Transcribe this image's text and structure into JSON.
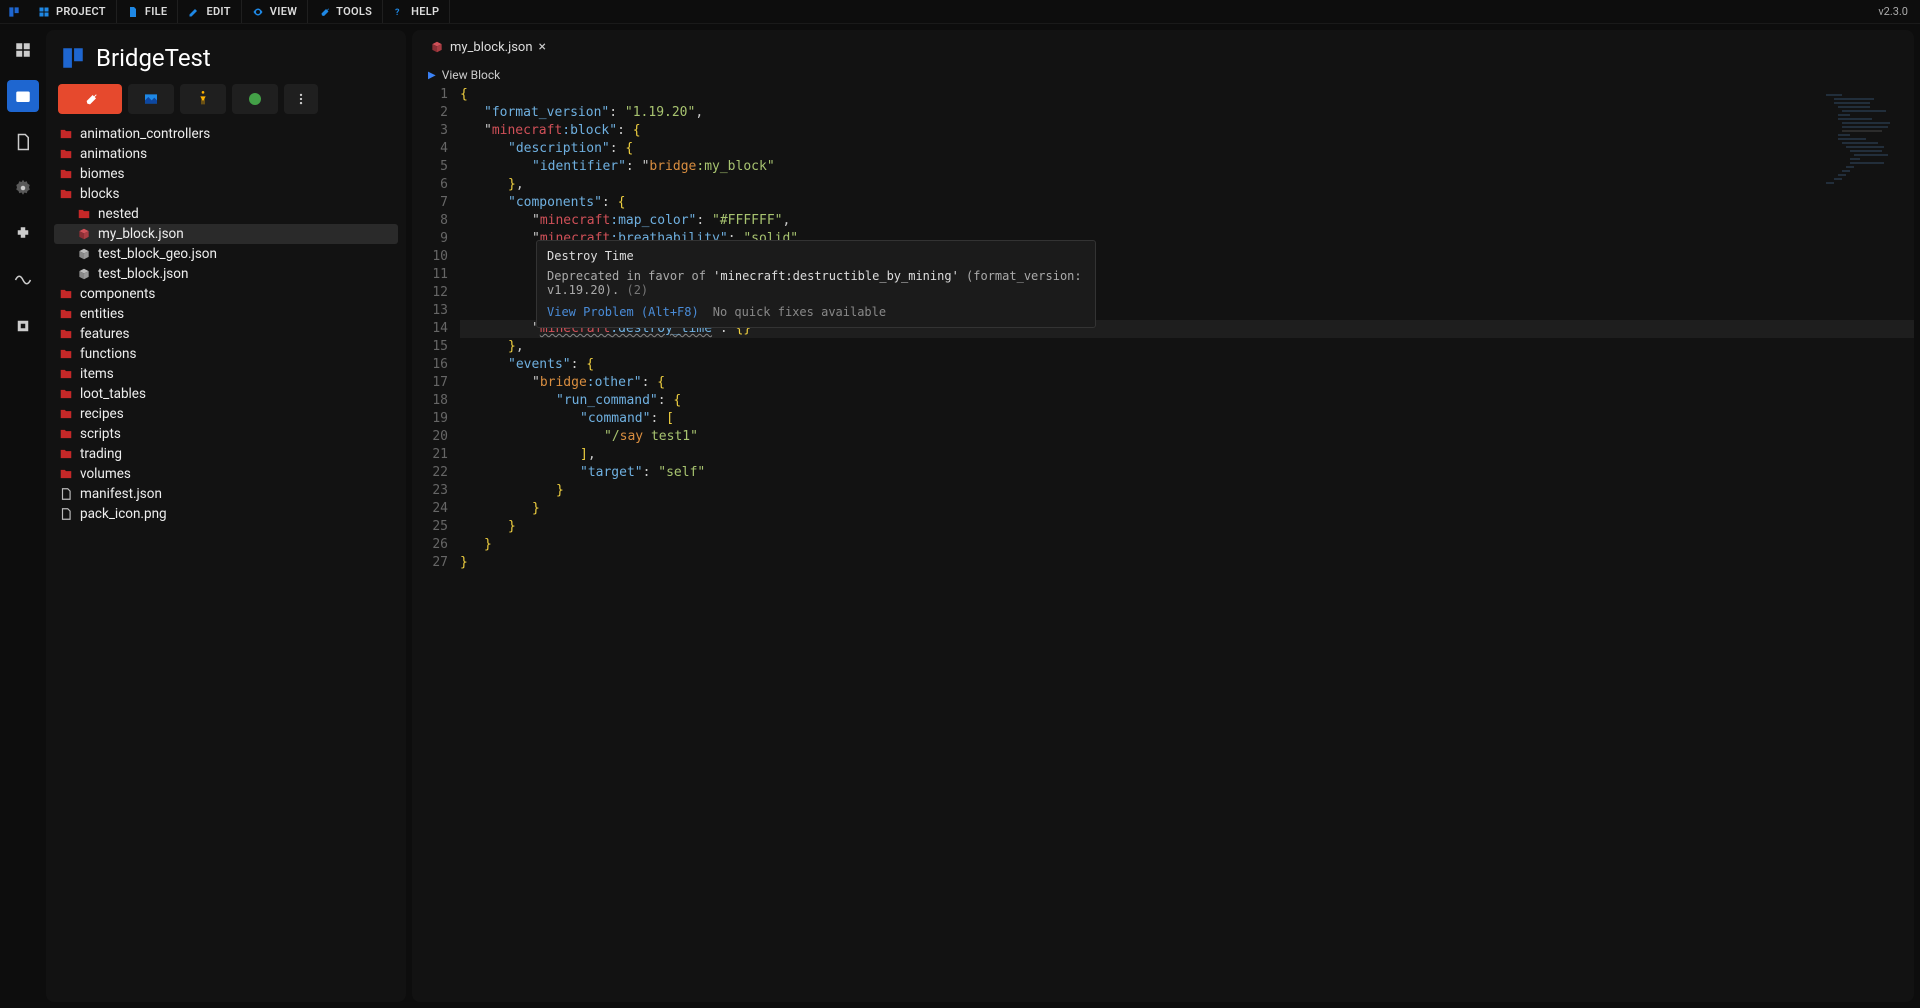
{
  "version": "v2.3.0",
  "menubar": {
    "items": [
      {
        "label": "PROJECT",
        "icon": "grid"
      },
      {
        "label": "FILE",
        "icon": "file"
      },
      {
        "label": "EDIT",
        "icon": "pencil"
      },
      {
        "label": "VIEW",
        "icon": "eye"
      },
      {
        "label": "TOOLS",
        "icon": "wrench"
      },
      {
        "label": "HELP",
        "icon": "help"
      }
    ]
  },
  "project": {
    "title": "BridgeTest"
  },
  "rail": {
    "items": [
      {
        "name": "grid",
        "active": false
      },
      {
        "name": "pack-explorer",
        "active": true
      },
      {
        "name": "file",
        "active": false
      },
      {
        "name": "settings",
        "active": false
      },
      {
        "name": "extensions",
        "active": false
      },
      {
        "name": "wave",
        "active": false
      },
      {
        "name": "debug",
        "active": false
      }
    ]
  },
  "tree": [
    {
      "depth": 0,
      "type": "folder",
      "label": "animation_controllers"
    },
    {
      "depth": 0,
      "type": "folder",
      "label": "animations"
    },
    {
      "depth": 0,
      "type": "folder",
      "label": "biomes"
    },
    {
      "depth": 0,
      "type": "folder",
      "label": "blocks"
    },
    {
      "depth": 1,
      "type": "folder",
      "label": "nested"
    },
    {
      "depth": 1,
      "type": "json-active",
      "label": "my_block.json",
      "active": true
    },
    {
      "depth": 1,
      "type": "json",
      "label": "test_block_geo.json"
    },
    {
      "depth": 1,
      "type": "json",
      "label": "test_block.json"
    },
    {
      "depth": 0,
      "type": "folder",
      "label": "components"
    },
    {
      "depth": 0,
      "type": "folder",
      "label": "entities"
    },
    {
      "depth": 0,
      "type": "folder",
      "label": "features"
    },
    {
      "depth": 0,
      "type": "folder",
      "label": "functions"
    },
    {
      "depth": 0,
      "type": "folder",
      "label": "items"
    },
    {
      "depth": 0,
      "type": "folder",
      "label": "loot_tables"
    },
    {
      "depth": 0,
      "type": "folder",
      "label": "recipes"
    },
    {
      "depth": 0,
      "type": "folder",
      "label": "scripts"
    },
    {
      "depth": 0,
      "type": "folder",
      "label": "trading"
    },
    {
      "depth": 0,
      "type": "folder",
      "label": "volumes"
    },
    {
      "depth": 0,
      "type": "file",
      "label": "manifest.json"
    },
    {
      "depth": 0,
      "type": "file",
      "label": "pack_icon.png"
    }
  ],
  "tab": {
    "label": "my_block.json"
  },
  "breadcrumb": {
    "label": "View Block"
  },
  "hover": {
    "title": "Destroy Time",
    "body_pre": "Deprecated in favor of ",
    "body_code": "'minecraft:destructible_by_mining'",
    "body_post": " (format_version: v1.19.20). ",
    "count": "(2)",
    "link": "View Problem (Alt+F8)",
    "muted": "No quick fixes available"
  },
  "code": {
    "lines": 27,
    "highlight_line": 14,
    "tokens": [
      [
        {
          "c": "brace",
          "t": "{"
        }
      ],
      [
        {
          "i": 24
        },
        {
          "c": "key",
          "t": "\"format_version\""
        },
        {
          "c": "punct",
          "t": ": "
        },
        {
          "c": "str",
          "t": "\"1.19.20\""
        },
        {
          "c": "punct",
          "t": ","
        }
      ],
      [
        {
          "i": 24
        },
        {
          "c": "punct",
          "t": "\""
        },
        {
          "c": "ns-mc",
          "t": "minecraft"
        },
        {
          "c": "key",
          "t": ":block\""
        },
        {
          "c": "punct",
          "t": ": "
        },
        {
          "c": "brace",
          "t": "{"
        }
      ],
      [
        {
          "i": 48
        },
        {
          "c": "key",
          "t": "\"description\""
        },
        {
          "c": "punct",
          "t": ": "
        },
        {
          "c": "brace",
          "t": "{"
        }
      ],
      [
        {
          "i": 72
        },
        {
          "c": "key",
          "t": "\"identifier\""
        },
        {
          "c": "punct",
          "t": ": "
        },
        {
          "c": "punct",
          "t": "\""
        },
        {
          "c": "ns-br",
          "t": "bridge"
        },
        {
          "c": "str",
          "t": ":my_block\""
        }
      ],
      [
        {
          "i": 48
        },
        {
          "c": "brace",
          "t": "}"
        },
        {
          "c": "punct",
          "t": ","
        }
      ],
      [
        {
          "i": 48
        },
        {
          "c": "key",
          "t": "\"components\""
        },
        {
          "c": "punct",
          "t": ": "
        },
        {
          "c": "brace",
          "t": "{"
        }
      ],
      [
        {
          "i": 72
        },
        {
          "c": "punct",
          "t": "\""
        },
        {
          "c": "ns-mc",
          "t": "minecraft"
        },
        {
          "c": "key",
          "t": ":map_color\""
        },
        {
          "c": "punct",
          "t": ": "
        },
        {
          "c": "str",
          "t": "\"#FFFFFF\""
        },
        {
          "c": "punct",
          "t": ","
        }
      ],
      [
        {
          "i": 72
        },
        {
          "c": "punct",
          "t": "\""
        },
        {
          "c": "ns-mc",
          "t": "minecraft"
        },
        {
          "c": "key",
          "t": ":breathability\""
        },
        {
          "c": "punct",
          "t": ": "
        },
        {
          "c": "str",
          "t": "\"solid\""
        },
        {
          "c": "punct",
          "t": ","
        }
      ],
      [],
      [],
      [],
      [],
      [
        {
          "i": 72
        },
        {
          "c": "punct",
          "t": "\""
        },
        {
          "c": "ns-mc dep",
          "t": "minecraft"
        },
        {
          "c": "key dep",
          "t": ":destroy_time"
        },
        {
          "c": "punct",
          "t": "\": "
        },
        {
          "c": "brace",
          "t": "{}"
        }
      ],
      [
        {
          "i": 48
        },
        {
          "c": "brace",
          "t": "}"
        },
        {
          "c": "punct",
          "t": ","
        }
      ],
      [
        {
          "i": 48
        },
        {
          "c": "key",
          "t": "\"events\""
        },
        {
          "c": "punct",
          "t": ": "
        },
        {
          "c": "brace",
          "t": "{"
        }
      ],
      [
        {
          "i": 72
        },
        {
          "c": "punct",
          "t": "\""
        },
        {
          "c": "ns-br",
          "t": "bridge"
        },
        {
          "c": "key",
          "t": ":other\""
        },
        {
          "c": "punct",
          "t": ": "
        },
        {
          "c": "brace",
          "t": "{"
        }
      ],
      [
        {
          "i": 96
        },
        {
          "c": "key",
          "t": "\"run_command\""
        },
        {
          "c": "punct",
          "t": ": "
        },
        {
          "c": "brace",
          "t": "{"
        }
      ],
      [
        {
          "i": 120
        },
        {
          "c": "key",
          "t": "\"command\""
        },
        {
          "c": "punct",
          "t": ": "
        },
        {
          "c": "brace",
          "t": "["
        }
      ],
      [
        {
          "i": 144
        },
        {
          "c": "str",
          "t": "\"/"
        },
        {
          "c": "ns-br",
          "t": "say"
        },
        {
          "c": "str",
          "t": " test1\""
        }
      ],
      [
        {
          "i": 120
        },
        {
          "c": "brace",
          "t": "]"
        },
        {
          "c": "punct",
          "t": ","
        }
      ],
      [
        {
          "i": 120
        },
        {
          "c": "key",
          "t": "\"target\""
        },
        {
          "c": "punct",
          "t": ": "
        },
        {
          "c": "str",
          "t": "\"self\""
        }
      ],
      [
        {
          "i": 96
        },
        {
          "c": "brace",
          "t": "}"
        }
      ],
      [
        {
          "i": 72
        },
        {
          "c": "brace",
          "t": "}"
        }
      ],
      [
        {
          "i": 48
        },
        {
          "c": "brace",
          "t": "}"
        }
      ],
      [
        {
          "i": 24
        },
        {
          "c": "brace",
          "t": "}"
        }
      ],
      [
        {
          "c": "brace",
          "t": "}"
        }
      ]
    ]
  },
  "colors": {
    "accent_blue": "#1e66d0",
    "accent_orange": "#e6492d",
    "folder_red": "#c62828"
  }
}
